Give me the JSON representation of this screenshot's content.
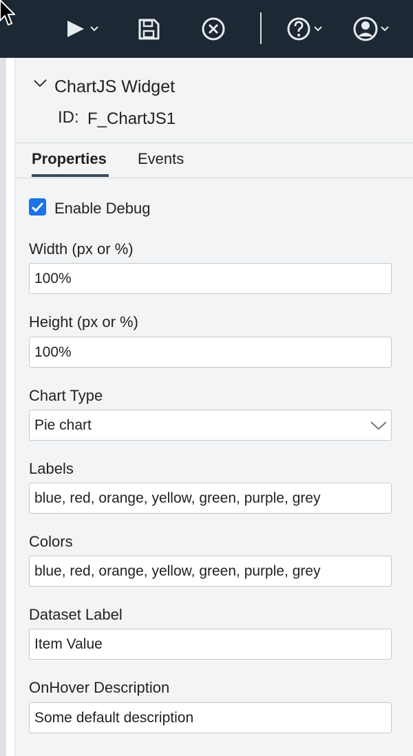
{
  "toolbar": {
    "icons": [
      "run-icon",
      "save-icon",
      "cancel-icon",
      "help-icon",
      "account-icon"
    ]
  },
  "panel": {
    "title": "ChartJS Widget",
    "id_label": "ID:",
    "id_value": "F_ChartJS1",
    "tabs": [
      {
        "label": "Properties",
        "active": true
      },
      {
        "label": "Events",
        "active": false
      }
    ],
    "enable_debug": {
      "label": "Enable Debug",
      "checked": true
    },
    "fields": {
      "width": {
        "label": "Width (px or %)",
        "value": "100%"
      },
      "height": {
        "label": "Height (px or %)",
        "value": "100%"
      },
      "chart_type": {
        "label": "Chart Type",
        "value": "Pie chart"
      },
      "labels": {
        "label": "Labels",
        "value": "blue, red, orange, yellow, green, purple, grey"
      },
      "colors": {
        "label": "Colors",
        "value": "blue, red, orange, yellow, green, purple, grey"
      },
      "dataset_label": {
        "label": "Dataset Label",
        "value": "Item Value"
      },
      "onhover_description": {
        "label": "OnHover Description",
        "value": "Some default description"
      }
    }
  },
  "colors": {
    "toolbar_bg": "#1c2833",
    "panel_bg": "#f3f4f5",
    "checkbox_accent": "#1a73e8",
    "tab_underline": "#3b4a57"
  }
}
